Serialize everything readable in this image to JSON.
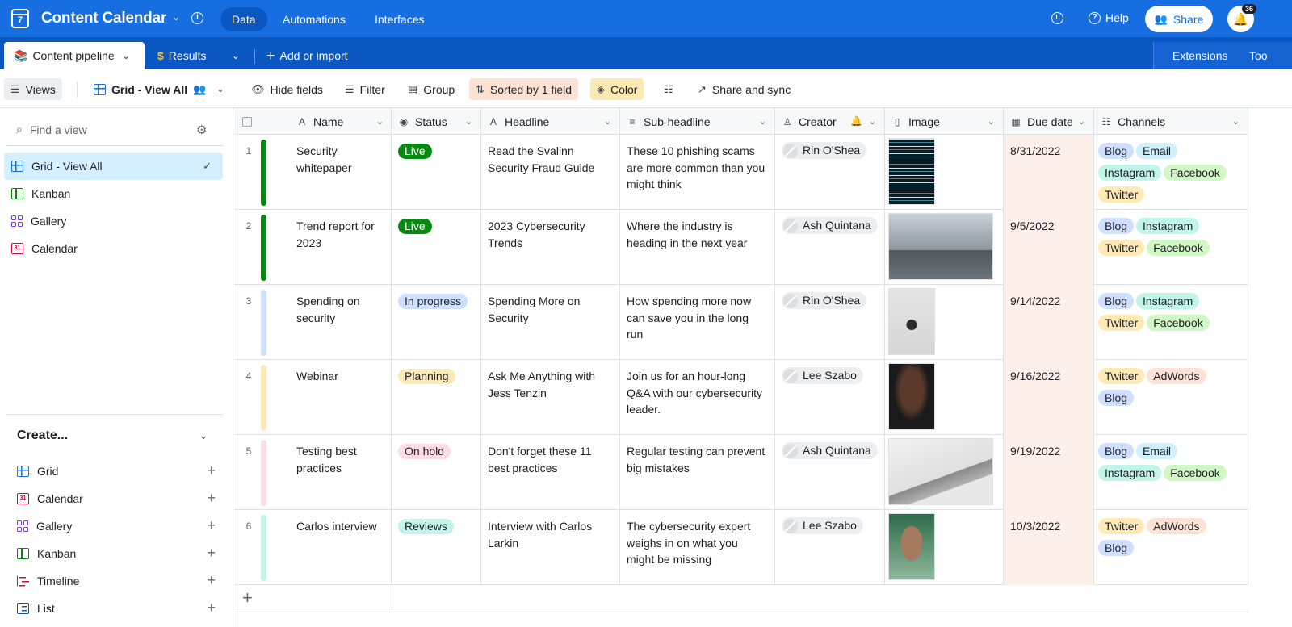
{
  "topbar": {
    "app_icon_text": "7",
    "title": "Content Calendar",
    "nav": [
      "Data",
      "Automations",
      "Interfaces"
    ],
    "help": "Help",
    "share": "Share",
    "notifications": "36"
  },
  "tabs": {
    "active": "Content pipeline",
    "active_icon": "📚",
    "results": "Results",
    "results_icon": "$",
    "add": "Add or import",
    "extensions": "Extensions",
    "tools": "Too"
  },
  "viewbar": {
    "views": "Views",
    "current_view": "Grid - View All",
    "hide_fields": "Hide fields",
    "filter": "Filter",
    "group": "Group",
    "sorted": "Sorted by 1 field",
    "color": "Color",
    "share_sync": "Share and sync"
  },
  "sidebar": {
    "find_placeholder": "Find a view",
    "views": [
      {
        "label": "Grid - View All",
        "icon": "grid-icon"
      },
      {
        "label": "Kanban",
        "icon": "kanban-icon"
      },
      {
        "label": "Gallery",
        "icon": "gallery-icon"
      },
      {
        "label": "Calendar",
        "icon": "calendar-icon"
      }
    ],
    "create_header": "Create...",
    "create_items": [
      {
        "label": "Grid",
        "icon": "grid-icon"
      },
      {
        "label": "Calendar",
        "icon": "calendar-icon"
      },
      {
        "label": "Gallery",
        "icon": "gallery-icon"
      },
      {
        "label": "Kanban",
        "icon": "kanban-icon"
      },
      {
        "label": "Timeline",
        "icon": "timeline-icon"
      },
      {
        "label": "List",
        "icon": "list-icon"
      }
    ]
  },
  "columns": [
    "Name",
    "Status",
    "Headline",
    "Sub-headline",
    "Creator",
    "Image",
    "Due date",
    "Channels"
  ],
  "rows": [
    {
      "num": "1",
      "name": "Security whitepaper",
      "status": "Live",
      "headline": "Read the Svalinn Security Fraud Guide",
      "subheadline": "These 10 phishing scams are more common than you might think",
      "creator": "Rin O'Shea",
      "due": "8/31/2022",
      "channels": [
        "Blog",
        "Email",
        "Instagram",
        "Facebook",
        "Twitter"
      ]
    },
    {
      "num": "2",
      "name": "Trend report for 2023",
      "status": "Live",
      "headline": "2023 Cybersecurity Trends",
      "subheadline": "Where the industry is heading in the next year",
      "creator": "Ash Quintana",
      "due": "9/5/2022",
      "channels": [
        "Blog",
        "Instagram",
        "Twitter",
        "Facebook"
      ]
    },
    {
      "num": "3",
      "name": "Spending on security",
      "status": "In progress",
      "headline": "Spending More on Security",
      "subheadline": "How spending more now can save you in the long run",
      "creator": "Rin O'Shea",
      "due": "9/14/2022",
      "channels": [
        "Blog",
        "Instagram",
        "Twitter",
        "Facebook"
      ]
    },
    {
      "num": "4",
      "name": "Webinar",
      "status": "Planning",
      "headline": "Ask Me Anything with Jess Tenzin",
      "subheadline": "Join us for an hour-long Q&A with our cybersecurity leader.",
      "creator": "Lee Szabo",
      "due": "9/16/2022",
      "channels": [
        "Twitter",
        "AdWords",
        "Blog"
      ]
    },
    {
      "num": "5",
      "name": "Testing best practices",
      "status": "On hold",
      "headline": "Don't forget these 11 best practices",
      "subheadline": "Regular testing can prevent big mistakes",
      "creator": "Ash Quintana",
      "due": "9/19/2022",
      "channels": [
        "Blog",
        "Email",
        "Instagram",
        "Facebook"
      ]
    },
    {
      "num": "6",
      "name": "Carlos interview",
      "status": "Reviews",
      "headline": "Interview with Carlos Larkin",
      "subheadline": "The cybersecurity expert weighs in on what you might be missing",
      "creator": "Lee Szabo",
      "due": "10/3/2022",
      "channels": [
        "Twitter",
        "AdWords",
        "Blog"
      ]
    }
  ],
  "colors": {
    "brand": "#166ee1",
    "status_live": "#048a0e",
    "status_in_progress": "#cfdfff",
    "status_planning": "#ffeab6",
    "status_on_hold": "#ffdce5",
    "status_reviews": "#c2f5e9",
    "chip_blog": "#cfdfff",
    "chip_email": "#d0f0fd",
    "chip_instagram": "#c2f5e9",
    "chip_facebook": "#d1f7c4",
    "chip_twitter": "#ffeab6",
    "chip_adwords": "#fee2d5"
  }
}
